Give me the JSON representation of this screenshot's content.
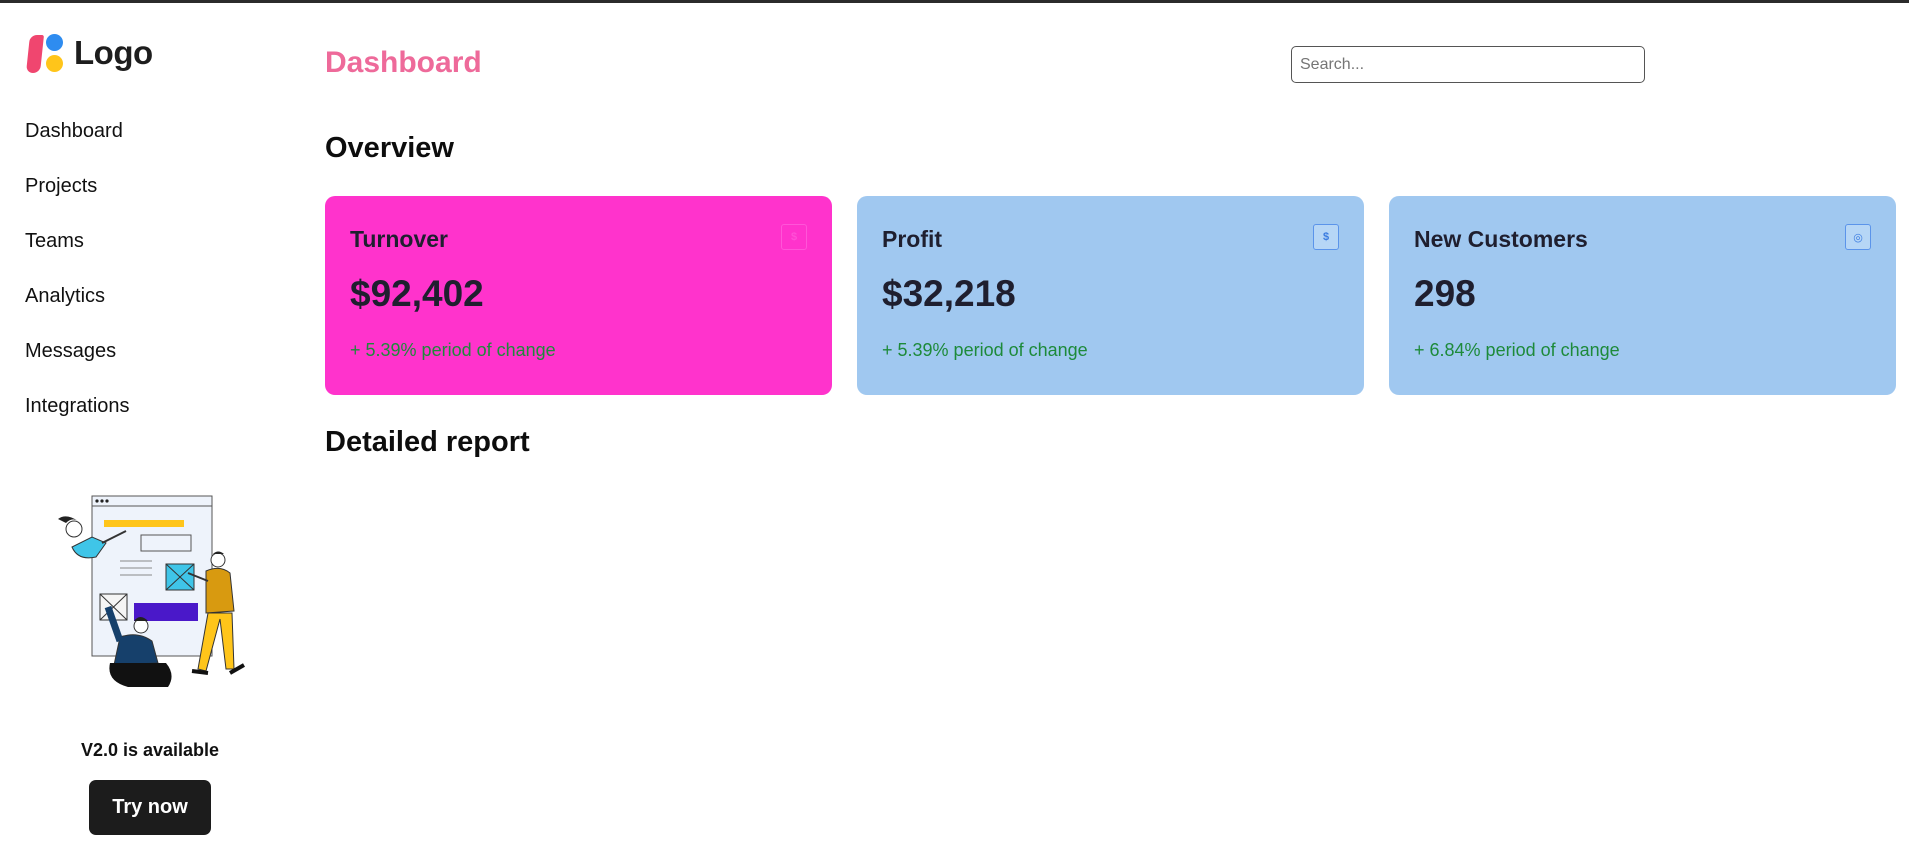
{
  "brand": {
    "logo_text": "Logo"
  },
  "sidebar": {
    "items": [
      {
        "label": "Dashboard"
      },
      {
        "label": "Projects"
      },
      {
        "label": "Teams"
      },
      {
        "label": "Analytics"
      },
      {
        "label": "Messages"
      },
      {
        "label": "Integrations"
      }
    ],
    "promo": {
      "version_text": "V2.0 is available",
      "button_label": "Try now"
    }
  },
  "header": {
    "title": "Dashboard",
    "search_placeholder": "Search..."
  },
  "overview": {
    "heading": "Overview",
    "cards": [
      {
        "title": "Turnover",
        "value": "$92,402",
        "change": "+ 5.39% period of change",
        "icon": "dollar-icon",
        "icon_glyph": "$",
        "bg": "#ff33cc"
      },
      {
        "title": "Profit",
        "value": "$32,218",
        "change": "+ 5.39% period of change",
        "icon": "dollar-icon",
        "icon_glyph": "$",
        "bg": "#a0c8f0"
      },
      {
        "title": "New Customers",
        "value": "298",
        "change": "+ 6.84% period of change",
        "icon": "user-icon",
        "icon_glyph": "◎",
        "bg": "#a0c8f0"
      }
    ]
  },
  "report": {
    "heading": "Detailed report"
  },
  "colors": {
    "title_pink": "#ee6a9a",
    "turnover_card": "#ff33cc",
    "blue_card": "#a0c8f0",
    "change_green": "#1d8a3a",
    "button_dark": "#1c1c1c"
  }
}
